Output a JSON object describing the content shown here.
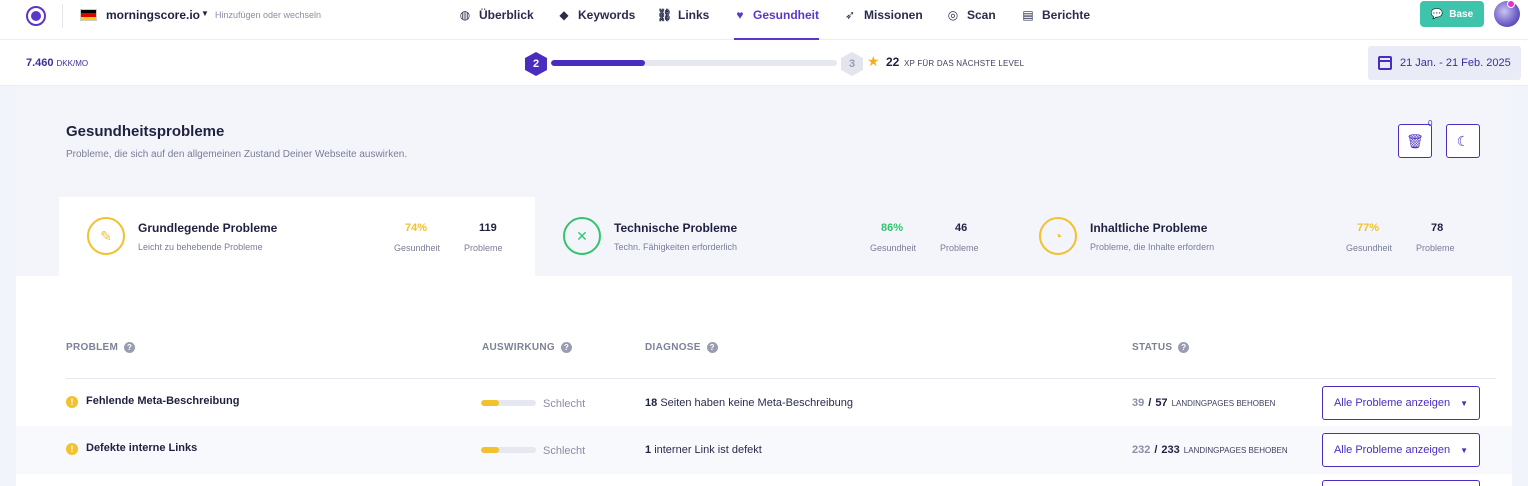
{
  "nav": {
    "site_name": "morningscore.io",
    "site_hint": "Hinzufügen oder wechseln",
    "items": [
      {
        "label": "Überblick",
        "icon": "planet-icon"
      },
      {
        "label": "Keywords",
        "icon": "tag-icon"
      },
      {
        "label": "Links",
        "icon": "link-icon"
      },
      {
        "label": "Gesundheit",
        "icon": "heart-icon",
        "active": true
      },
      {
        "label": "Missionen",
        "icon": "rocket-icon"
      },
      {
        "label": "Scan",
        "icon": "radar-icon"
      },
      {
        "label": "Berichte",
        "icon": "document-icon"
      }
    ],
    "base_label": "Base"
  },
  "status": {
    "budget_value": "7.460",
    "budget_unit": "DKK/MO",
    "level_current": "2",
    "level_next": "3",
    "xp_progress_fraction": 0.33,
    "xp_points": "22",
    "xp_label": "XP FÜR DAS NÄCHSTE LEVEL",
    "date_range": "21 Jan. - 21 Feb. 2025"
  },
  "health": {
    "title": "Gesundheitsprobleme",
    "subtitle": "Probleme, die sich auf den allgemeinen Zustand Deiner Webseite auswirken.",
    "trash_count": "0",
    "categories": [
      {
        "title": "Grundlegende Probleme",
        "sub": "Leicht zu behebende Probleme",
        "pct": "74%",
        "pct_label": "Gesundheit",
        "count": "119",
        "count_label": "Probleme",
        "color": "#f2c12e"
      },
      {
        "title": "Technische Probleme",
        "sub": "Techn. Fähigkeiten erforderlich",
        "pct": "86%",
        "pct_label": "Gesundheit",
        "count": "46",
        "count_label": "Probleme",
        "color": "#35c46d"
      },
      {
        "title": "Inhaltliche Probleme",
        "sub": "Probleme, die Inhalte erfordern",
        "pct": "77%",
        "pct_label": "Gesundheit",
        "count": "78",
        "count_label": "Probleme",
        "color": "#f2c12e"
      }
    ]
  },
  "table": {
    "headers": {
      "problem": "PROBLEM",
      "impact": "AUSWIRKUNG",
      "diagnosis": "DIAGNOSE",
      "status": "STATUS"
    },
    "rows": [
      {
        "name": "Fehlende Meta-Beschreibung",
        "impact_level": 0.33,
        "impact_label": "Schlecht",
        "diag_num": "18",
        "diag_text": "Seiten haben keine Meta-Beschreibung",
        "done": "39",
        "total": "57",
        "status_label": "LANDINGPAGES BEHOBEN",
        "button": "Alle Probleme anzeigen"
      },
      {
        "name": "Defekte interne Links",
        "impact_level": 0.33,
        "impact_label": "Schlecht",
        "diag_num": "1",
        "diag_text": "interner Link ist defekt",
        "done": "232",
        "total": "233",
        "status_label": "LANDINGPAGES BEHOBEN",
        "button": "Alle Probleme anzeigen"
      }
    ]
  },
  "colors": {
    "accent": "#4a2dbf",
    "teal": "#3dc4ab",
    "warning": "#f2c12e",
    "good": "#35c46d"
  }
}
